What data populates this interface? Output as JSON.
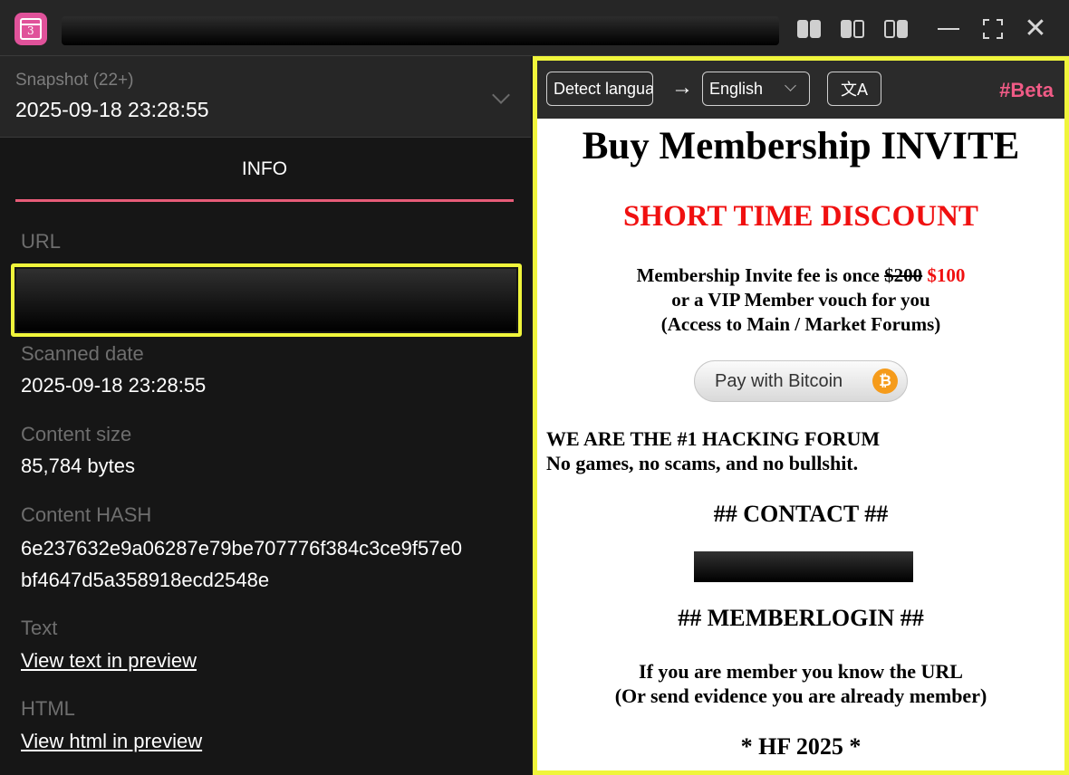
{
  "titlebar": {
    "app_icon_glyph": "3",
    "icons": [
      "layout-left-icon",
      "layout-split-icon",
      "layout-right-icon",
      "minimize-icon",
      "maximize-icon",
      "close-icon"
    ]
  },
  "snapshot": {
    "label": "Snapshot (22+)",
    "value": "2025-09-18 23:28:55"
  },
  "tab": {
    "label": "INFO"
  },
  "info": {
    "url_label": "URL",
    "scanned_label": "Scanned date",
    "scanned_value": "2025-09-18 23:28:55",
    "size_label": "Content size",
    "size_value": "85,784 bytes",
    "hash_label": "Content HASH",
    "hash_line1": "6e237632e9a06287e79be707776f384c3ce9f57e0",
    "hash_line2": "bf4647d5a358918ecd2548e",
    "text_label": "Text",
    "text_link": "View text in preview",
    "html_label": "HTML",
    "html_link": "View html in preview"
  },
  "translator": {
    "source_lang": "Detect langua",
    "arrow": "→",
    "target_lang": "English",
    "translate_glyph": "文A",
    "beta": "#Beta"
  },
  "page": {
    "title": "Buy Membership INVITE",
    "discount": "SHORT TIME DISCOUNT",
    "fee_prefix": "Membership Invite fee is once ",
    "fee_old": "$200",
    "fee_new": "$100",
    "fee_line2": "or a VIP Member vouch for you",
    "fee_line3": "(Access to Main / Market Forums)",
    "pay_button": "Pay with Bitcoin",
    "btc_symbol": "₿",
    "forum_line1": "WE ARE THE #1 HACKING FORUM",
    "forum_line2": "No games, no scams, and no bullshit.",
    "contact_heading": "## CONTACT ##",
    "memberlogin_heading": "## MEMBERLOGIN ##",
    "member_line1": "If you are member you know the URL",
    "member_line2": "(Or send evidence you are already member)",
    "footer": "* HF 2025 *"
  },
  "colors": {
    "accent_pink": "#e75c78",
    "highlight_yellow": "#f0f53b",
    "beta_pink": "#f05b86",
    "discount_red": "#f01010",
    "bitcoin_orange": "#f59b1b"
  }
}
